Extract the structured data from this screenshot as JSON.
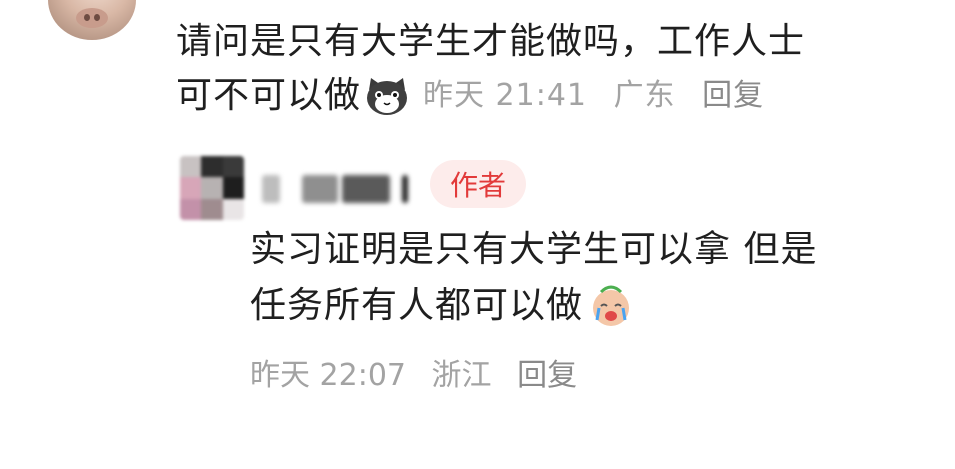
{
  "comment": {
    "line1": "请问是只有大学生才能做吗，工作人士",
    "line2": "可不可以做",
    "emoji": "cat-sticker",
    "time": "昨天 21:41",
    "location": "广东",
    "reply_label": "回复"
  },
  "reply": {
    "author_badge": "作者",
    "line1": "实习证明是只有大学生可以拿 但是",
    "line2": "任务所有人都可以做",
    "emoji": "crying-baby",
    "time": "昨天 22:07",
    "location": "浙江",
    "reply_label": "回复"
  },
  "colors": {
    "text": "#1f1f1f",
    "meta": "#a3a3a3",
    "badge_bg": "#fdeceb",
    "badge_text": "#e23a3a"
  }
}
